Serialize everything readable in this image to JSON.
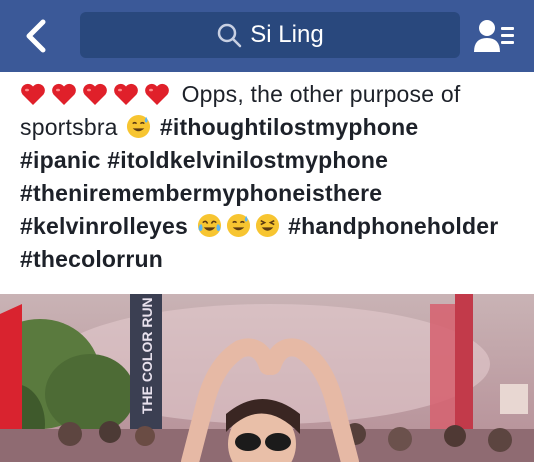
{
  "header": {
    "search_text": "Si Ling",
    "colors": {
      "bar": "#3b5998",
      "search_field": "#29487d"
    },
    "icons": [
      "back-chevron-icon",
      "search-icon",
      "friends-list-icon"
    ]
  },
  "post": {
    "line1_text": "Opps, the other purpose of",
    "line2_text": "sportsbra",
    "tags": {
      "t1": "#ithoughtilostmyphone",
      "t2": "#ipanic",
      "t3": "#itoldkelvinilostmyphone",
      "t4": "#theniremembermyphoneisthere",
      "t5": "#kelvinrolleyes",
      "t6": "#handphoneholder",
      "t7": "#thecolorrun"
    },
    "emojis": [
      "heart",
      "heart",
      "heart",
      "heart",
      "heart",
      "sweat-smile",
      "tears-of-joy",
      "sweat-smile",
      "laughing"
    ]
  },
  "photo": {
    "banner_text": "THE COLOR RUN"
  }
}
